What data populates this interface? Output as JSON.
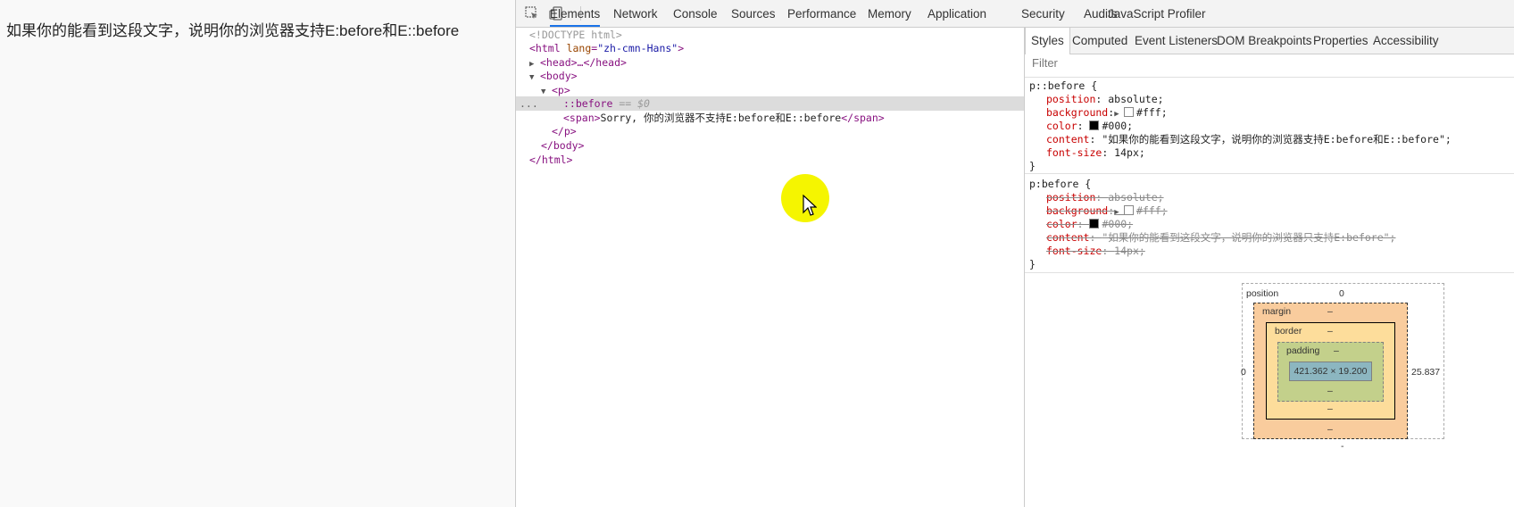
{
  "page": {
    "text": "如果你的能看到这段文字，说明你的浏览器支持E:before和E::before"
  },
  "devtools": {
    "toolbar": {
      "inspect_icon": "cursor-select-icon",
      "device_icon": "device-toggle-icon",
      "tabs": [
        "Elements",
        "Network",
        "Console",
        "Sources",
        "Performance",
        "Memory",
        "Application",
        "Security",
        "Audits",
        "JavaScript Profiler"
      ],
      "active_tab": "Elements"
    },
    "elements": {
      "doctype": "<!DOCTYPE html>",
      "html_open_tag": "<html",
      "html_attr_name": "lang",
      "html_attr_value": "\"zh-cmn-Hans\"",
      "html_open_close": ">",
      "head_collapsed": "<head>…</head>",
      "body_open": "<body>",
      "p_open": "<p>",
      "pseudo": "::before",
      "pseudo_ref": "== $0",
      "span_open": "<span>",
      "span_text": "Sorry, 你的浏览器不支持E:before和E::before",
      "span_close": "</span>",
      "p_close": "</p>",
      "body_close": "</body>",
      "html_close": "</html>",
      "row_dots": "..."
    },
    "sidebar": {
      "tabs": [
        "Styles",
        "Computed",
        "Event Listeners",
        "DOM Breakpoints",
        "Properties",
        "Accessibility"
      ],
      "active_tab": "Styles",
      "filter_placeholder": "Filter",
      "rules": [
        {
          "selector": "p::before {",
          "props": [
            {
              "name": "position",
              "value": "absolute;"
            },
            {
              "name": "background",
              "value": "#fff;",
              "swatch": "#ffffff",
              "arrow": true
            },
            {
              "name": "color",
              "value": "#000;",
              "swatch": "#000000"
            },
            {
              "name": "content",
              "value": "\"如果你的能看到这段文字，说明你的浏览器支持E:before和E::before\";"
            },
            {
              "name": "font-size",
              "value": "14px;"
            }
          ],
          "close": "}"
        },
        {
          "selector": "p:before {",
          "props": [
            {
              "name": "position",
              "value": "absolute;"
            },
            {
              "name": "background",
              "value": "#fff;",
              "swatch": "#ffffff",
              "arrow": true
            },
            {
              "name": "color",
              "value": "#000;",
              "swatch": "#000000"
            },
            {
              "name": "content",
              "value": "\"如果你的能看到这段文字，说明你的浏览器只支持E:before\";"
            },
            {
              "name": "font-size",
              "value": "14px;"
            }
          ],
          "close": "}"
        }
      ],
      "box_model": {
        "position_label": "position",
        "position_value": "0",
        "margin_label": "margin",
        "border_label": "border",
        "padding_label": "padding",
        "dash": "–",
        "content_size": "421.362 × 19.200",
        "left_value": "0",
        "right_value": "25.837",
        "bottom_outer": "-"
      }
    }
  },
  "colors": {
    "highlight": "#f5f500",
    "tag": "#881280",
    "prop": "#c80000"
  }
}
